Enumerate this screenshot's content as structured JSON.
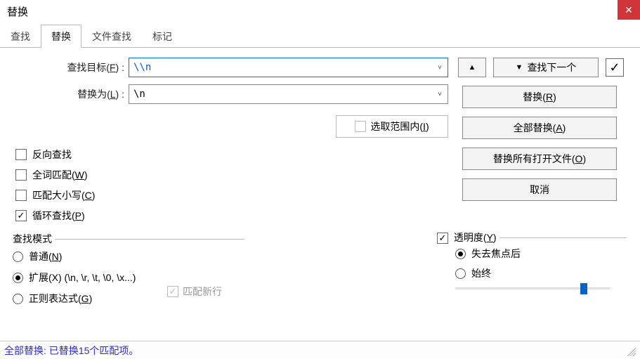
{
  "window": {
    "title": "替换"
  },
  "tabs": [
    "查找",
    "替换",
    "文件查找",
    "标记"
  ],
  "activeTabIndex": 1,
  "fields": {
    "find_label": "查找目标(F) :",
    "find_value": "\\\\n",
    "replace_label": "替换为(L) :",
    "replace_value": "\\n"
  },
  "row1": {
    "up_glyph": "▲",
    "findnext_glyph": "▼",
    "findnext_label": "查找下一个",
    "endcheck_glyph": "✓"
  },
  "inSelection": {
    "label": "选取范围内(I)",
    "checked": false,
    "enabled": false
  },
  "rightButtons": {
    "replace": "替换(R)",
    "replaceAll": "全部替换(A)",
    "replaceAllOpen": "替换所有打开文件(O)",
    "cancel": "取消"
  },
  "leftOptions": [
    {
      "key": "backward",
      "label": "反向查找",
      "checked": false
    },
    {
      "key": "wholeword",
      "label": "全词匹配(W)",
      "checked": false
    },
    {
      "key": "matchcase",
      "label": "匹配大小写(C)",
      "checked": false
    },
    {
      "key": "wrap",
      "label": "循环查找(P)",
      "checked": true
    }
  ],
  "searchMode": {
    "title": "查找模式",
    "options": [
      {
        "key": "normal",
        "label": "普通(N)",
        "selected": false
      },
      {
        "key": "extended",
        "label": "扩展(X) (\\n, \\r, \\t, \\0, \\x...)",
        "selected": true
      },
      {
        "key": "regex",
        "label": "正则表达式(G)",
        "selected": false
      }
    ],
    "matchNewline": {
      "label": "匹配新行",
      "checked": true,
      "enabled": false
    }
  },
  "transparency": {
    "enabled": true,
    "title": "透明度(Y)",
    "options": [
      {
        "key": "onlosefocus",
        "label": "失去焦点后",
        "selected": true
      },
      {
        "key": "always",
        "label": "始终",
        "selected": false
      }
    ],
    "sliderValue": 80
  },
  "status": "全部替换:  已替换15个匹配项。",
  "glyphs": {
    "check": "✓",
    "caret": "˅"
  }
}
